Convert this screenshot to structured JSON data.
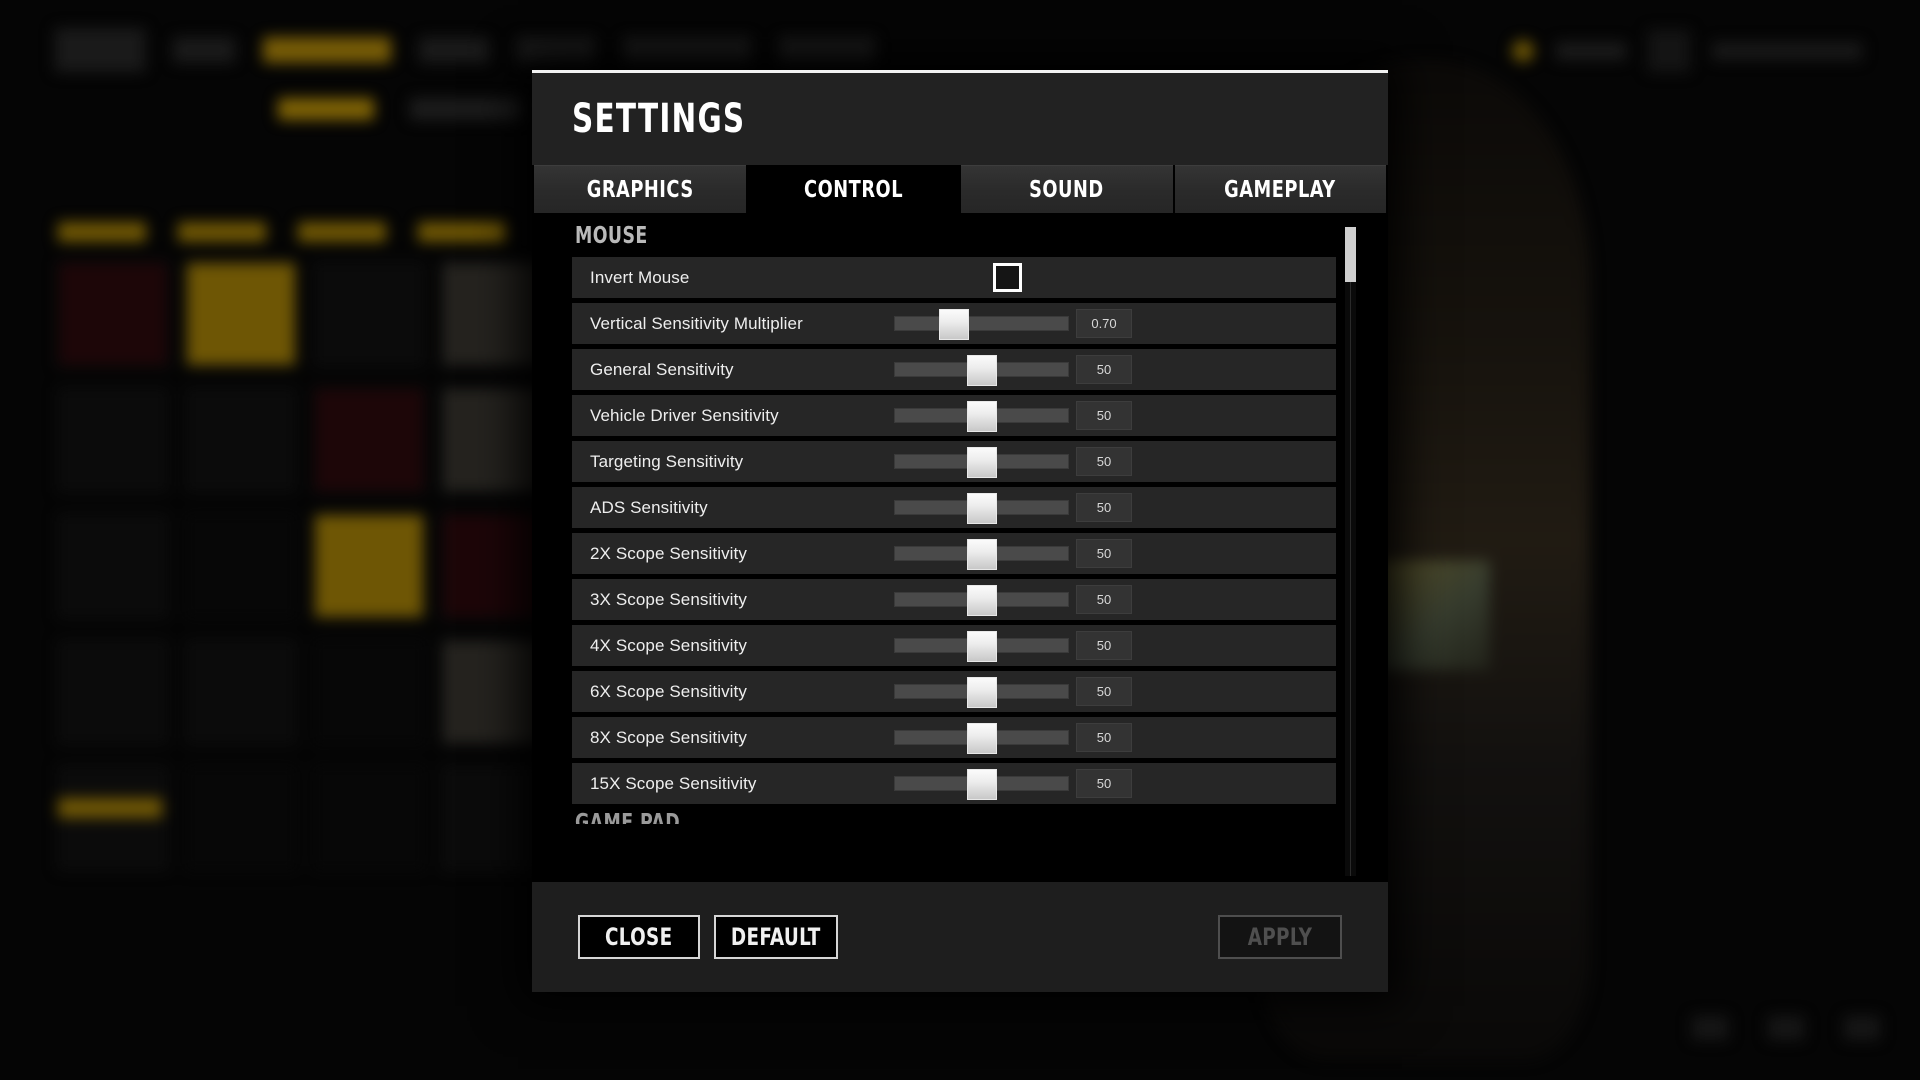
{
  "background": {
    "nav_items_count": 6,
    "accent_gold": "#7e6206"
  },
  "modal": {
    "title": "SETTINGS",
    "tabs": [
      {
        "label": "GRAPHICS",
        "active": false
      },
      {
        "label": "CONTROL",
        "active": true
      },
      {
        "label": "SOUND",
        "active": false
      },
      {
        "label": "GAMEPLAY",
        "active": false
      }
    ],
    "sections": [
      {
        "heading": "MOUSE",
        "rows": [
          {
            "label": "Invert Mouse",
            "type": "checkbox",
            "checked": false
          },
          {
            "label": "Vertical Sensitivity Multiplier",
            "type": "slider",
            "value": "0.70",
            "percent": 34
          },
          {
            "label": "General Sensitivity",
            "type": "slider",
            "value": "50",
            "percent": 50
          },
          {
            "label": "Vehicle Driver Sensitivity",
            "type": "slider",
            "value": "50",
            "percent": 50
          },
          {
            "label": "Targeting Sensitivity",
            "type": "slider",
            "value": "50",
            "percent": 50
          },
          {
            "label": "ADS Sensitivity",
            "type": "slider",
            "value": "50",
            "percent": 50
          },
          {
            "label": "2X Scope Sensitivity",
            "type": "slider",
            "value": "50",
            "percent": 50
          },
          {
            "label": "3X Scope Sensitivity",
            "type": "slider",
            "value": "50",
            "percent": 50
          },
          {
            "label": "4X Scope Sensitivity",
            "type": "slider",
            "value": "50",
            "percent": 50
          },
          {
            "label": "6X Scope Sensitivity",
            "type": "slider",
            "value": "50",
            "percent": 50
          },
          {
            "label": "8X Scope Sensitivity",
            "type": "slider",
            "value": "50",
            "percent": 50
          },
          {
            "label": "15X Scope Sensitivity",
            "type": "slider",
            "value": "50",
            "percent": 50
          }
        ]
      },
      {
        "heading": "GAME PAD",
        "rows": []
      }
    ],
    "scrollbar": {
      "thumb_top_percent": 0,
      "thumb_height_percent": 8
    },
    "footer": {
      "close_label": "CLOSE",
      "default_label": "DEFAULT",
      "apply_label": "APPLY",
      "apply_enabled": false
    }
  }
}
